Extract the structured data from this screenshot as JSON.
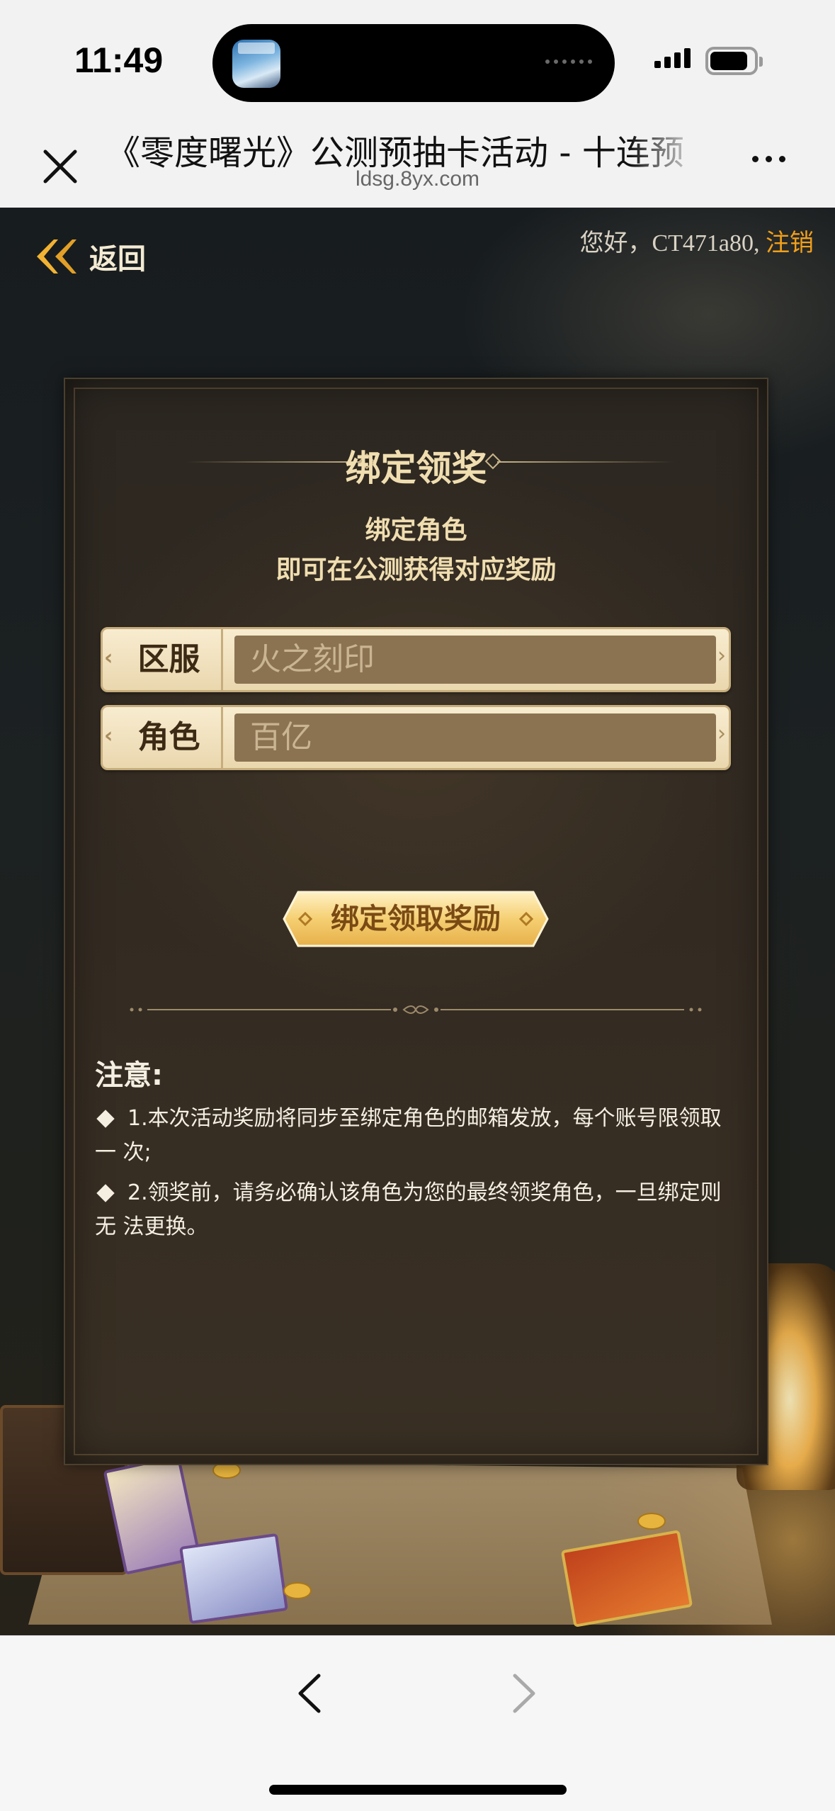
{
  "status_bar": {
    "time": "11:49"
  },
  "browser": {
    "page_title": "《零度曙光》公测预抽卡活动 - 十连预",
    "domain": "ldsg.8yx.com"
  },
  "header": {
    "back_label": "返回",
    "greeting": "您好，CT471a80, ",
    "logout_label": "注销"
  },
  "panel": {
    "title": "绑定领奖",
    "subtitle_line1": "绑定角色",
    "subtitle_line2": "即可在公测获得对应奖励",
    "server_field": {
      "label": "区服",
      "value": "火之刻印"
    },
    "role_field": {
      "label": "角色",
      "value": "百亿"
    },
    "claim_button_label": "绑定领取奖励"
  },
  "notice": {
    "title": "注意:",
    "items": [
      "1.本次活动奖励将同步至绑定角色的邮箱发放，每个账号限领取一 次;",
      "2.领奖前，请务必确认该角色为您的最终领奖角色，一旦绑定则无 法更换。"
    ]
  },
  "colors": {
    "accent_gold": "#f2a01a",
    "title_cream": "#f0deb0",
    "button_gold": "#f5cf72"
  }
}
